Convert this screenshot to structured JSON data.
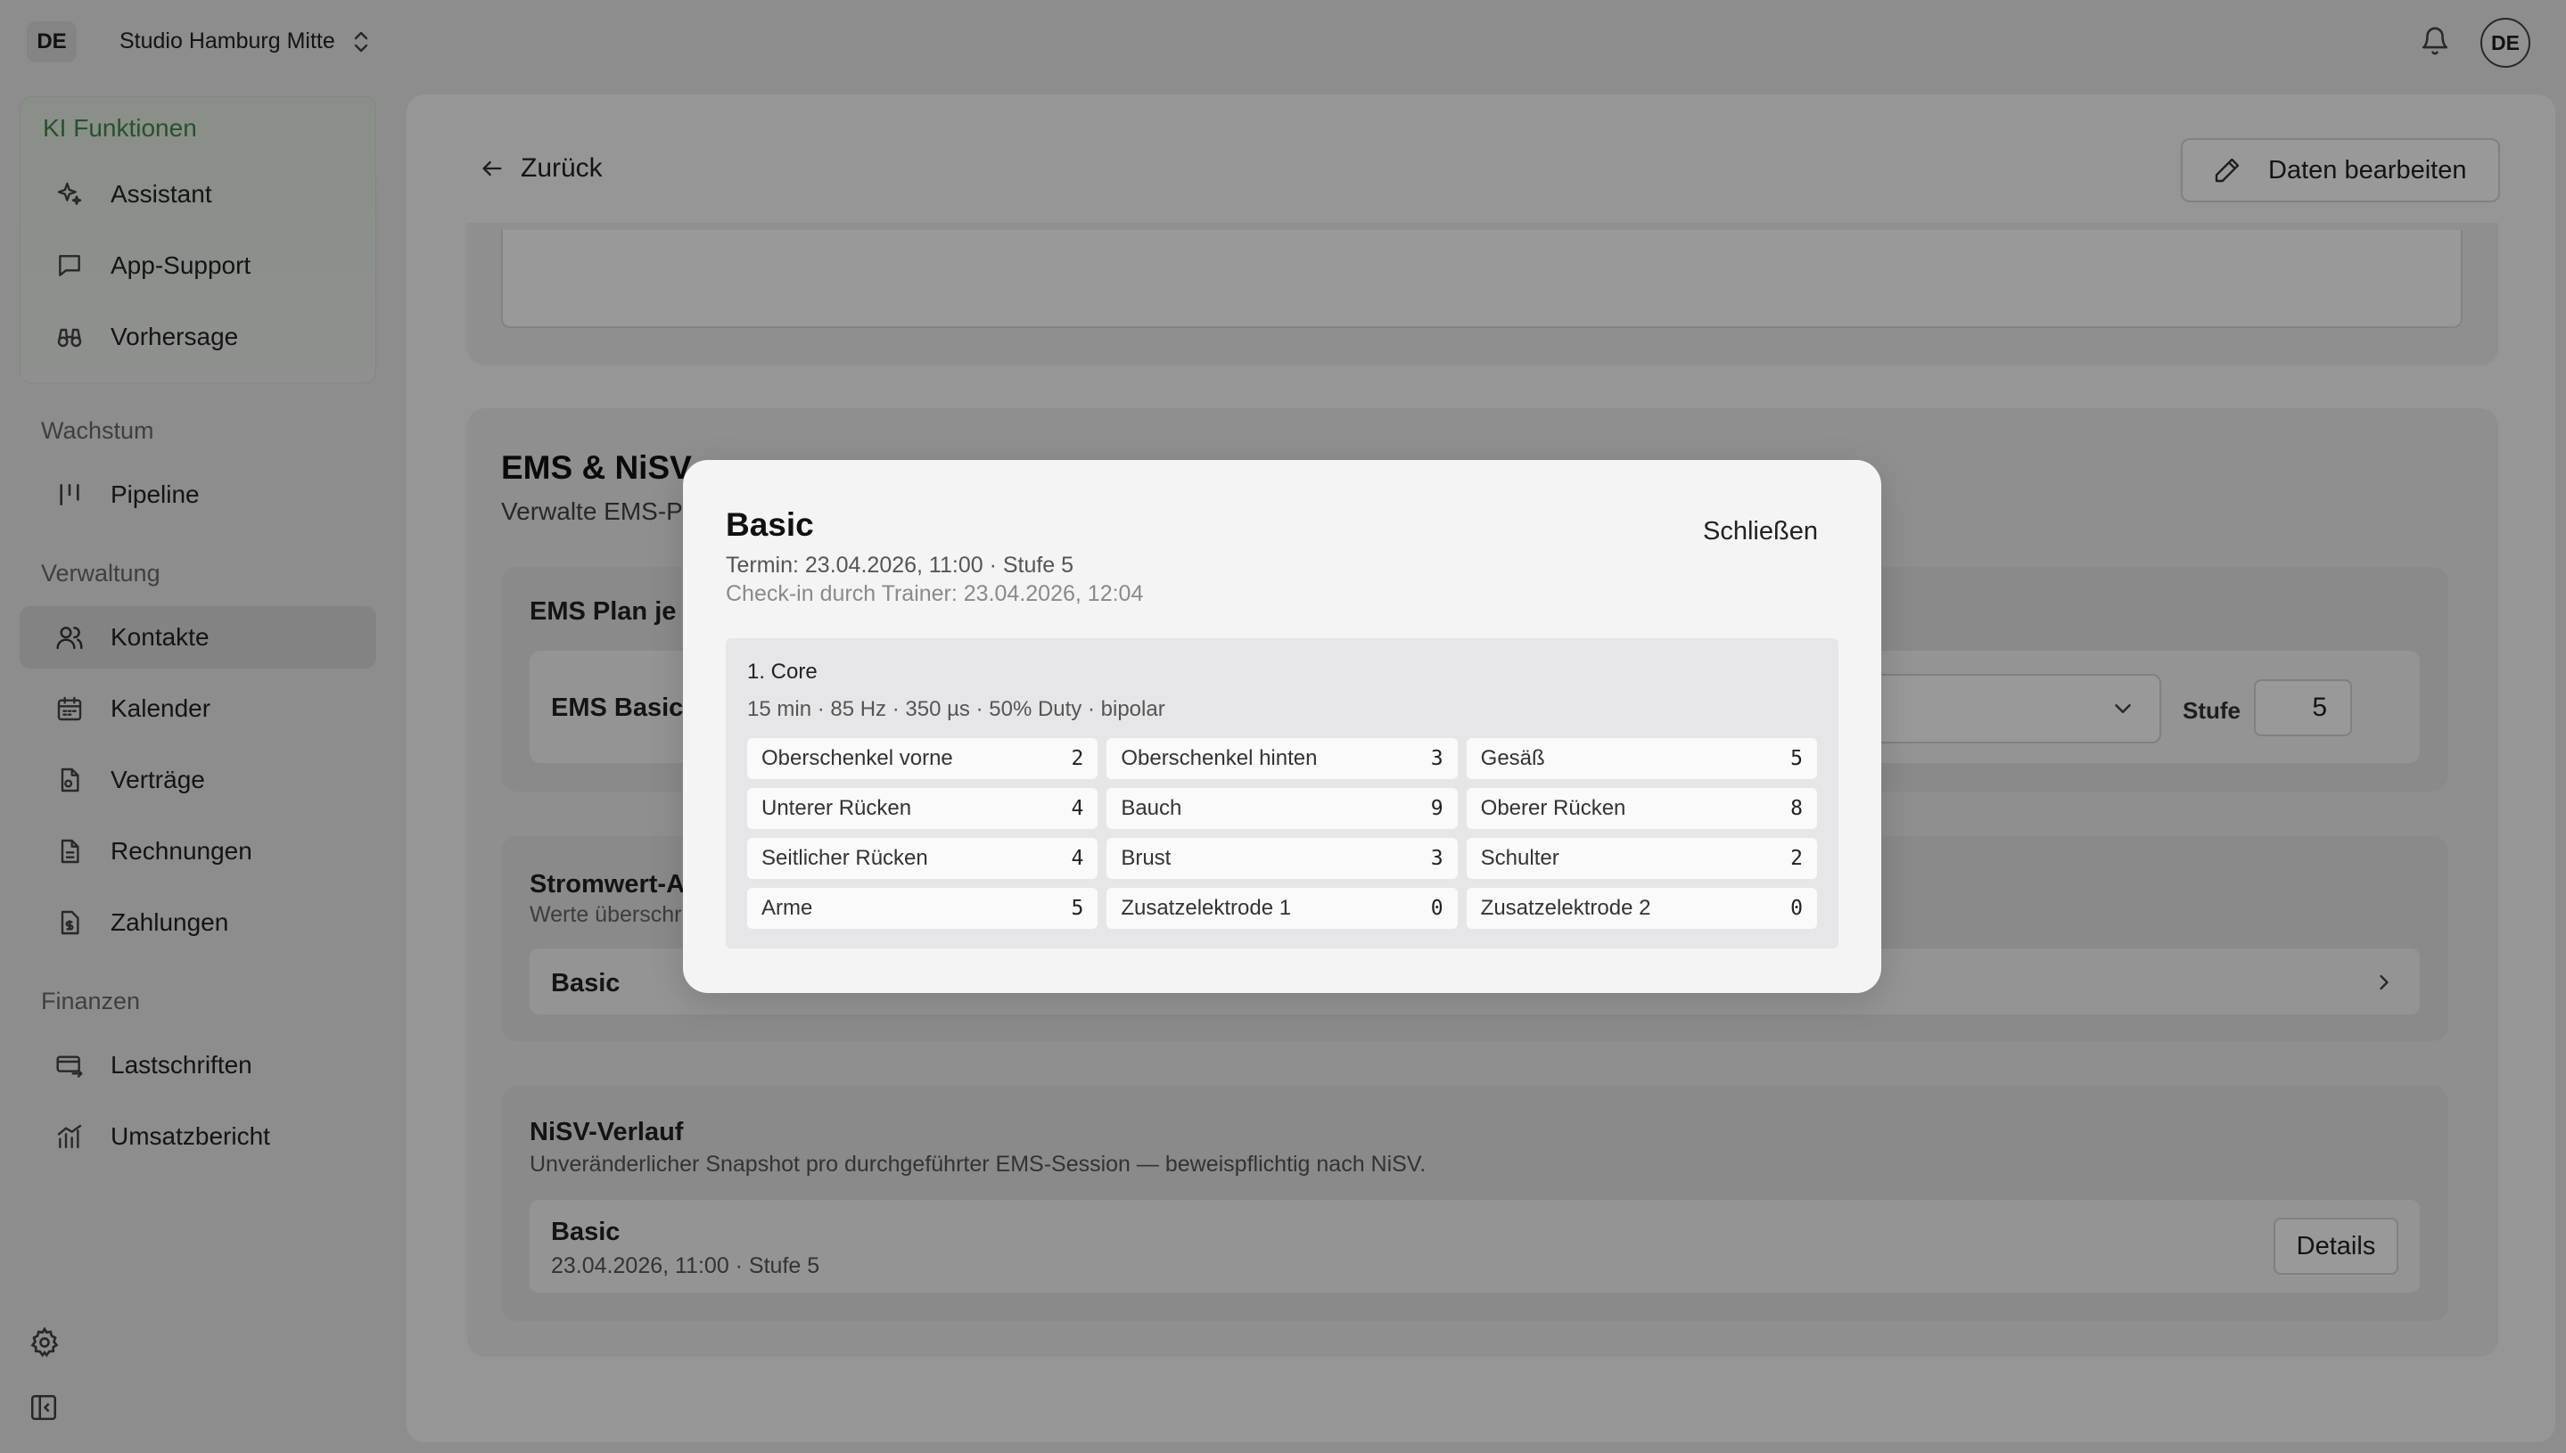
{
  "workspace": {
    "badge": "DE",
    "name": "Studio Hamburg Mitte"
  },
  "user": {
    "initials": "DE"
  },
  "sidebar": {
    "ki_title": "KI Funktionen",
    "ki_items": [
      {
        "label": "Assistant",
        "icon": "sparkles-icon"
      },
      {
        "label": "App-Support",
        "icon": "chat-icon"
      },
      {
        "label": "Vorhersage",
        "icon": "binoculars-icon"
      }
    ],
    "sections": {
      "wachstum": "Wachstum",
      "verwaltung": "Verwaltung",
      "finanzen": "Finanzen"
    },
    "wachstum_items": [
      {
        "label": "Pipeline",
        "icon": "pipeline-icon"
      }
    ],
    "verwaltung_items": [
      {
        "label": "Kontakte",
        "icon": "users-icon",
        "active": true
      },
      {
        "label": "Kalender",
        "icon": "calendar-icon"
      },
      {
        "label": "Verträge",
        "icon": "contract-icon"
      },
      {
        "label": "Rechnungen",
        "icon": "invoice-icon"
      },
      {
        "label": "Zahlungen",
        "icon": "payment-icon"
      }
    ],
    "finanzen_items": [
      {
        "label": "Lastschriften",
        "icon": "direct-debit-icon"
      },
      {
        "label": "Umsatzbericht",
        "icon": "chart-icon"
      }
    ]
  },
  "header": {
    "back_label": "Zurück",
    "edit_label": "Daten bearbeiten"
  },
  "ems": {
    "title": "EMS & NiSV",
    "subtitle": "Verwalte EMS-P",
    "plan": {
      "title": "EMS Plan je T",
      "row_label": "EMS Basic",
      "stufe_label": "Stufe",
      "stufe_value": "5"
    },
    "stromwert": {
      "title": "Stromwert-A",
      "subtitle": "Werte überschr",
      "row_label": "Basic"
    },
    "nisv": {
      "title": "NiSV-Verlauf",
      "subtitle": "Unveränderlicher Snapshot pro durchgeführter EMS-Session — beweispflichtig nach NiSV.",
      "entry_name": "Basic",
      "entry_meta": "23.04.2026, 11:00 · Stufe 5",
      "details_label": "Details"
    }
  },
  "modal": {
    "title": "Basic",
    "close_label": "Schließen",
    "termin": "Termin: 23.04.2026, 11:00 · Stufe 5",
    "checkin": "Check-in durch Trainer: 23.04.2026, 12:04",
    "block": {
      "title": "1. Core",
      "params": "15 min · 85 Hz · 350 µs · 50% Duty · bipolar",
      "cells": [
        {
          "label": "Oberschenkel vorne",
          "value": "2"
        },
        {
          "label": "Oberschenkel hinten",
          "value": "3"
        },
        {
          "label": "Gesäß",
          "value": "5"
        },
        {
          "label": "Unterer Rücken",
          "value": "4"
        },
        {
          "label": "Bauch",
          "value": "9"
        },
        {
          "label": "Oberer Rücken",
          "value": "8"
        },
        {
          "label": "Seitlicher Rücken",
          "value": "4"
        },
        {
          "label": "Brust",
          "value": "3"
        },
        {
          "label": "Schulter",
          "value": "2"
        },
        {
          "label": "Arme",
          "value": "5"
        },
        {
          "label": "Zusatzelektrode 1",
          "value": "0"
        },
        {
          "label": "Zusatzelektrode 2",
          "value": "0"
        }
      ]
    }
  }
}
